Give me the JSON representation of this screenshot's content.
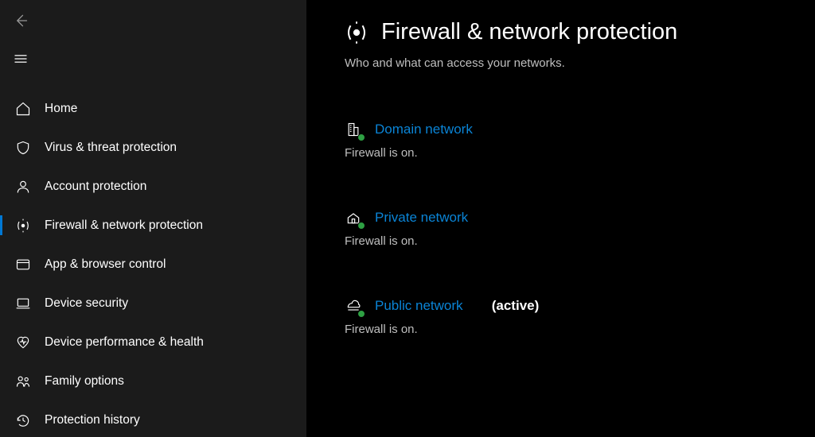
{
  "sidebar": {
    "items": [
      {
        "label": "Home"
      },
      {
        "label": "Virus & threat protection"
      },
      {
        "label": "Account protection"
      },
      {
        "label": "Firewall & network protection"
      },
      {
        "label": "App & browser control"
      },
      {
        "label": "Device security"
      },
      {
        "label": "Device performance & health"
      },
      {
        "label": "Family options"
      },
      {
        "label": "Protection history"
      }
    ]
  },
  "main": {
    "title": "Firewall & network protection",
    "subtitle": "Who and what can access your networks.",
    "networks": {
      "domain": {
        "label": "Domain network",
        "status": "Firewall is on."
      },
      "private": {
        "label": "Private network",
        "status": "Firewall is on."
      },
      "public": {
        "label": "Public network",
        "active_suffix": "(active)",
        "status": "Firewall is on."
      }
    }
  }
}
